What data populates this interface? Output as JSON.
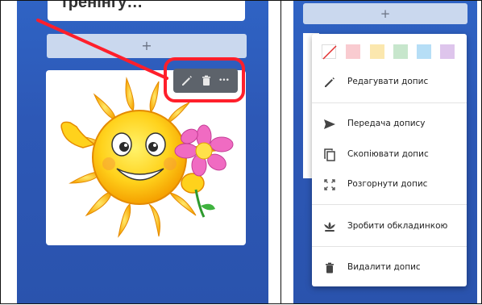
{
  "left_panel": {
    "top_card_text": "тренінгу…",
    "add_button_label": "+",
    "toolbar": {
      "edit_icon": "pencil-icon",
      "delete_icon": "trash-icon",
      "more_icon": "more-horizontal-icon",
      "more_glyph": "•••"
    },
    "highlight_color": "#ff1f2b"
  },
  "right_panel": {
    "add_button_label": "+",
    "colors": [
      {
        "name": "no-color",
        "hex": "#ffffff"
      },
      {
        "name": "red",
        "hex": "#f9cbd0"
      },
      {
        "name": "yellow",
        "hex": "#fbe7ae"
      },
      {
        "name": "green",
        "hex": "#c7e6cc"
      },
      {
        "name": "blue",
        "hex": "#b6def6"
      },
      {
        "name": "purple",
        "hex": "#dec5ec"
      }
    ],
    "menu": {
      "edit": "Редагувати допис",
      "transfer": "Передача допису",
      "copy": "Скопіювати допис",
      "expand": "Розгорнути допис",
      "make_cover": "Зробити обкладинкою",
      "delete": "Видалити допис"
    }
  }
}
